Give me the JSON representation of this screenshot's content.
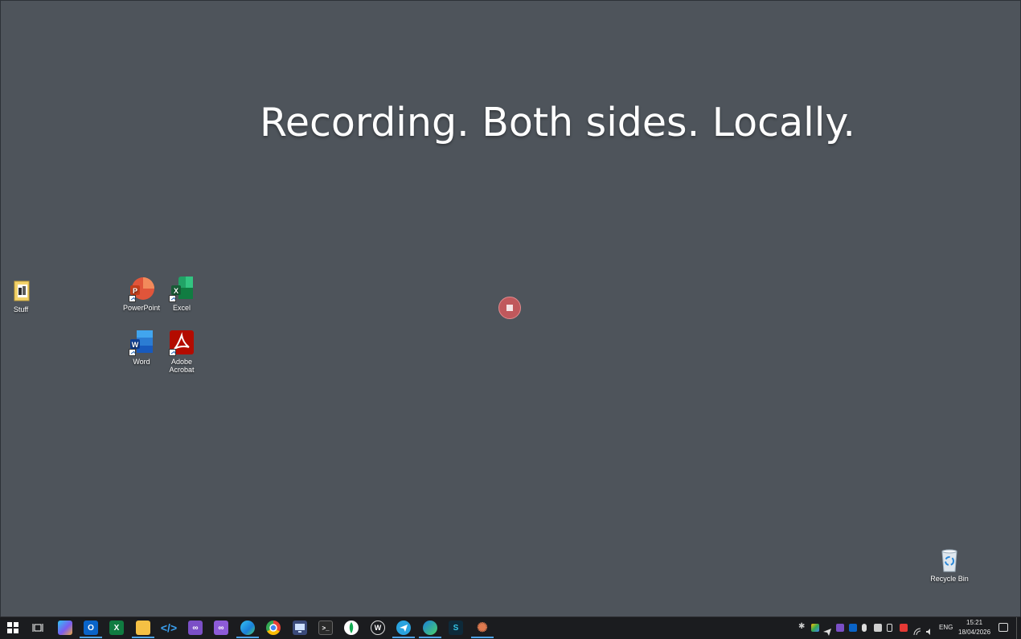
{
  "headline": "Recording. Both sides. Locally.",
  "desktop_icons": {
    "stuff": "Stuff",
    "powerpoint": "PowerPoint",
    "excel": "Excel",
    "word": "Word",
    "acrobat_line1": "Adobe",
    "acrobat_line2": "Acrobat",
    "recycle_bin": "Recycle Bin"
  },
  "taskbar": {
    "language": "ENG",
    "time": "15:21",
    "date": "18/04/2026",
    "pinned": [
      "start-icon",
      "task-view-icon",
      "copilot-icon",
      "outlook-icon",
      "excel-icon",
      "file-explorer-icon",
      "vscode-icon",
      "visual-studio-icon",
      "visual-studio-preview-icon",
      "edge-icon",
      "chrome-icon",
      "remote-desktop-icon",
      "terminal-icon",
      "mongodb-icon",
      "wordpress-icon",
      "telegram-icon",
      "edge-dev-icon",
      "app-s-icon",
      "claude-icon"
    ]
  },
  "colors": {
    "desktop_background": "#4e545b",
    "taskbar": "#1b1c1f",
    "record_button": "#c0585c",
    "running_indicator": "#4ea3e6"
  }
}
